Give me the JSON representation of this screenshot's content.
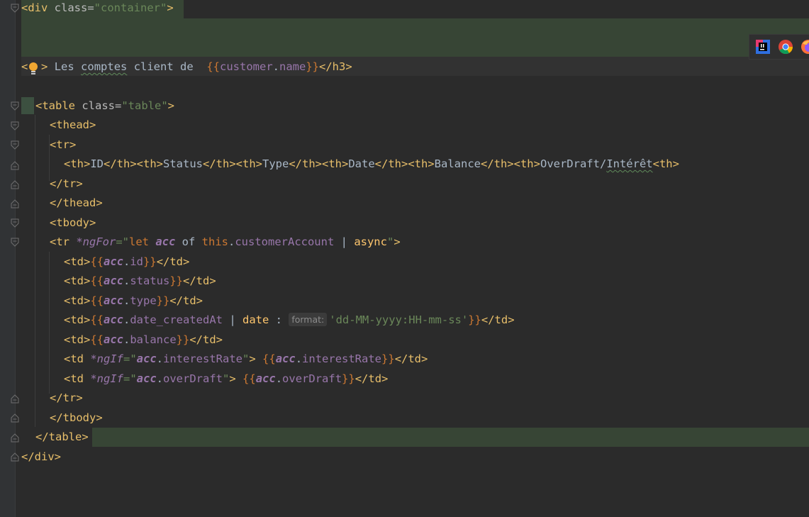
{
  "editor": {
    "lines": {
      "l1": {
        "open": "<div ",
        "attr": "class=",
        "val": "\"container\"",
        "close": ">"
      },
      "l2": {
        "lt": "<",
        "h": "h3",
        "gt": ">",
        "text_a": " Les ",
        "comptes": "comptes",
        "text_b": " client de  ",
        "interp_open": "{{",
        "obj": "customer",
        "dot": ".",
        "prop": "name",
        "interp_close": "}}",
        "end": "</h3>"
      },
      "l3": {
        "open": "<table ",
        "attr": "class=",
        "val": "\"table\"",
        "close": ">"
      },
      "l4": {
        "text": "<thead>"
      },
      "l5": {
        "text": "<tr>"
      },
      "l6": {
        "a": "<th>",
        "id": "ID",
        "b": "</th><th>",
        "status": "Status",
        "c": "</th><th>",
        "type": "Type",
        "d": "</th><th>",
        "date": "Date",
        "e": "</th><th>",
        "balance": "Balance",
        "f": "</th><th>",
        "over": "OverDraft/",
        "interet": "Intérêt",
        "g": "<th>"
      },
      "l7": {
        "text": "</tr>"
      },
      "l8": {
        "text": "</thead>"
      },
      "l9": {
        "text": "<tbody>"
      },
      "l10": {
        "open": "<tr ",
        "ngfor": "*ngFor",
        "eq": "=\"",
        "let": "let ",
        "acc": "acc",
        "of": " of ",
        "this": "this",
        "dot": ".",
        "prop": "customerAccount",
        "pipe": " | ",
        "async": "async",
        "q": "\"",
        "close": ">"
      },
      "l11": {
        "open": "<td>",
        "io": "{{",
        "acc": "acc",
        "dot": ".",
        "prop": "id",
        "ic": "}}",
        "close": "</td>"
      },
      "l12": {
        "open": "<td>",
        "io": "{{",
        "acc": "acc",
        "dot": ".",
        "prop": "status",
        "ic": "}}",
        "close": "</td>"
      },
      "l13": {
        "open": "<td>",
        "io": "{{",
        "acc": "acc",
        "dot": ".",
        "prop": "type",
        "ic": "}}",
        "close": "</td>"
      },
      "l14": {
        "open": "<td>",
        "io": "{{",
        "acc": "acc",
        "dot": ".",
        "prop": "date_createdAt",
        "pipe": " | ",
        "date": "date",
        "colon": " : ",
        "hint": "format:",
        "fmt": "'dd-MM-yyyy:HH-mm-ss'",
        "ic": "}}",
        "close": "</td>"
      },
      "l15": {
        "open": "<td>",
        "io": "{{",
        "acc": "acc",
        "dot": ".",
        "prop": "balance",
        "ic": "}}",
        "close": "</td>"
      },
      "l16": {
        "open": "<td ",
        "ngif": "*ngIf",
        "eq": "=\"",
        "acc": "acc",
        "dot": ".",
        "prop": "interestRate",
        "q": "\"",
        "gt": "> ",
        "io": "{{",
        "acc2": "acc",
        "dot2": ".",
        "prop2": "interestRate",
        "ic": "}}",
        "close": "</td>"
      },
      "l17": {
        "open": "<td ",
        "ngif": "*ngIf",
        "eq": "=\"",
        "acc": "acc",
        "dot": ".",
        "prop": "overDraft",
        "q": "\"",
        "gt": "> ",
        "io": "{{",
        "acc2": "acc",
        "dot2": ".",
        "prop2": "overDraft",
        "ic": "}}",
        "close": "</td>"
      },
      "l18": {
        "text": "</tr>"
      },
      "l19": {
        "text": "</tbody>"
      },
      "l20": {
        "text": "</table>"
      },
      "l21": {
        "text": "</div>"
      }
    },
    "browsers": [
      "jetbrains-icon",
      "chrome-icon",
      "firefox-icon"
    ]
  },
  "colors": {
    "background": "#2b2b2b",
    "tag": "#e8bf6a",
    "string": "#6a8759",
    "keyword": "#cc7832",
    "variable": "#9876aa",
    "highlight": "#374535"
  }
}
